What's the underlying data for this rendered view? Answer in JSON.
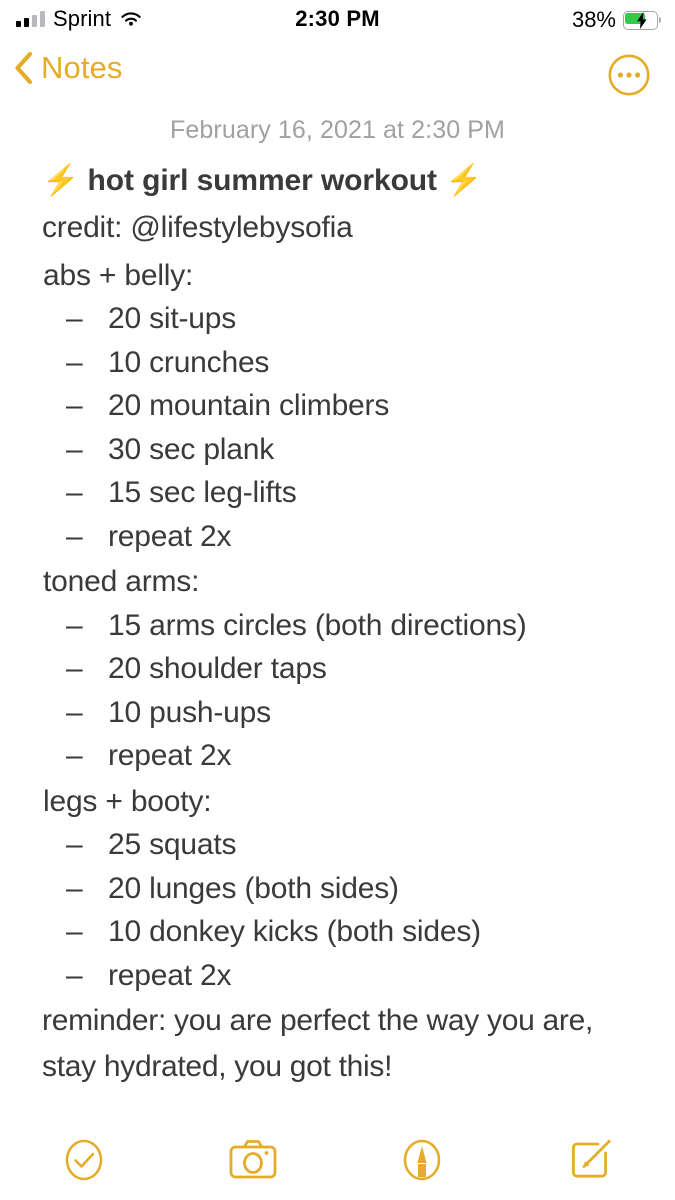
{
  "status_bar": {
    "carrier": "Sprint",
    "signal_bars_filled": 2,
    "signal_bars_total": 4,
    "wifi_icon": "wifi-icon",
    "time": "2:30 PM",
    "battery_percent": "38%",
    "battery_level": 38,
    "battery_charging": true,
    "battery_fill_color": "#37c84a"
  },
  "nav": {
    "back_label": "Notes",
    "back_icon": "chevron-left-icon",
    "more_icon": "more-ellipsis-circle-icon",
    "accent_color": "#E5AC27"
  },
  "note": {
    "date": "February 16, 2021 at 2:30 PM",
    "title_bolt_left": "⚡",
    "title_text": "hot girl summer workout",
    "title_bolt_right": "⚡",
    "credit": "credit: @lifestylebysofia",
    "text_color": "#3a3a3c",
    "date_color": "#a0a0a5",
    "bullet": "–",
    "sections": [
      {
        "heading": "abs + belly:",
        "items": [
          "20 sit-ups",
          "10 crunches",
          "20 mountain climbers",
          "30 sec plank",
          "15 sec leg-lifts",
          "repeat 2x"
        ]
      },
      {
        "heading": "toned arms:",
        "items": [
          "15 arms circles (both directions)",
          "20 shoulder taps",
          "10 push-ups",
          "repeat 2x"
        ]
      },
      {
        "heading": "legs + booty:",
        "items": [
          "25 squats",
          "20 lunges (both sides)",
          "10 donkey kicks (both sides)",
          "repeat 2x"
        ]
      }
    ],
    "outro_line_1": "reminder: you are perfect the way you are,",
    "outro_line_2": "stay hydrated, you got this!"
  },
  "toolbar": {
    "items": [
      {
        "icon": "checklist-circle-icon",
        "label": "Checklist"
      },
      {
        "icon": "camera-icon",
        "label": "Camera"
      },
      {
        "icon": "markup-pen-circle-icon",
        "label": "Markup"
      },
      {
        "icon": "compose-icon",
        "label": "Compose"
      }
    ]
  }
}
